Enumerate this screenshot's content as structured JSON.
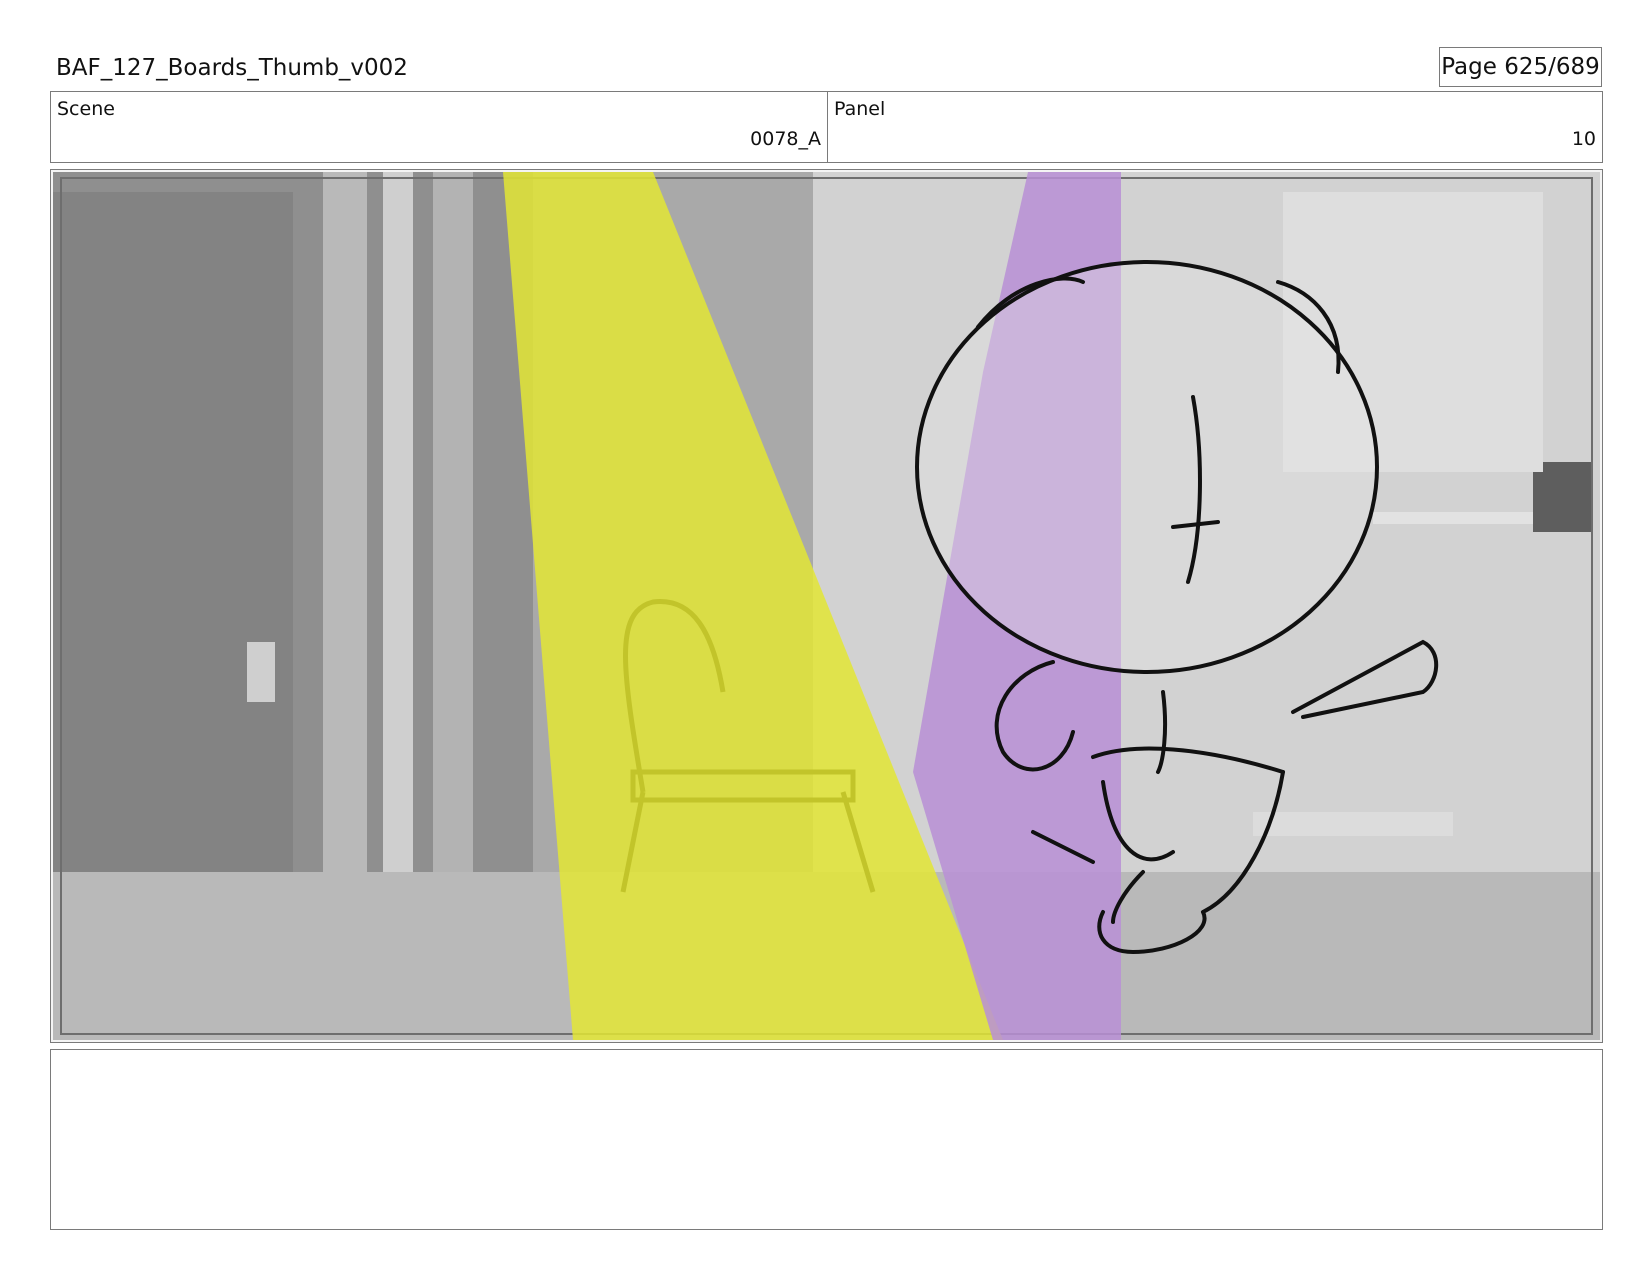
{
  "header": {
    "doc_title": "BAF_127_Boards_Thumb_v002",
    "page_indicator": "Page 625/689"
  },
  "info": {
    "scene_label": "Scene",
    "scene_value": "0078_A",
    "panel_label": "Panel",
    "panel_value": "10"
  },
  "frame": {
    "colors": {
      "yellow_beam": "#e3e635",
      "purple_beam": "#b88fd6",
      "background_gray": "#a9a9a9",
      "line": "#111111"
    },
    "icons": [
      "storyboard-frame-image",
      "character-sketch",
      "yellow-light-beam",
      "purple-light-beam"
    ]
  },
  "notes": {
    "text": ""
  }
}
